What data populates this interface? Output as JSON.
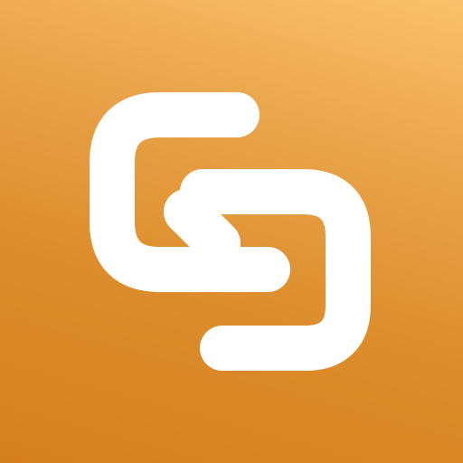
{
  "icon": {
    "name": "link-logo-icon",
    "background_colors": [
      "#FBC16C",
      "#E9A44A",
      "#DD8D2C",
      "#D5801E"
    ],
    "glyph_color": "#FFFFFF"
  }
}
